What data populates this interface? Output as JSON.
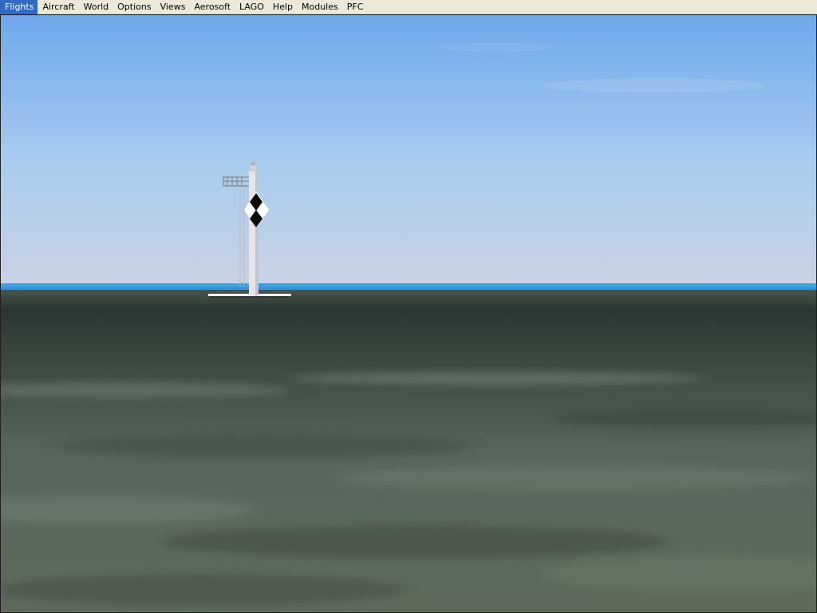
{
  "menu": {
    "items": [
      {
        "label": "Flights"
      },
      {
        "label": "Aircraft"
      },
      {
        "label": "World"
      },
      {
        "label": "Options"
      },
      {
        "label": "Views"
      },
      {
        "label": "Aerosoft"
      },
      {
        "label": "LAGO"
      },
      {
        "label": "Help"
      },
      {
        "label": "Modules"
      },
      {
        "label": "PFC"
      }
    ]
  },
  "scene": {
    "colors": {
      "sky_top": "#6ea7ec",
      "sky_mid": "#a9cdef",
      "sky_horizon": "#c9d2e2",
      "sea": "#3e9fe0",
      "ground_far": "#2a3630",
      "ground_mid": "#56665c",
      "ground_near": "#5e6b5b",
      "tower": "#e6e6ea",
      "daymark_black": "#0a0a0a",
      "daymark_white": "#ffffff"
    }
  }
}
